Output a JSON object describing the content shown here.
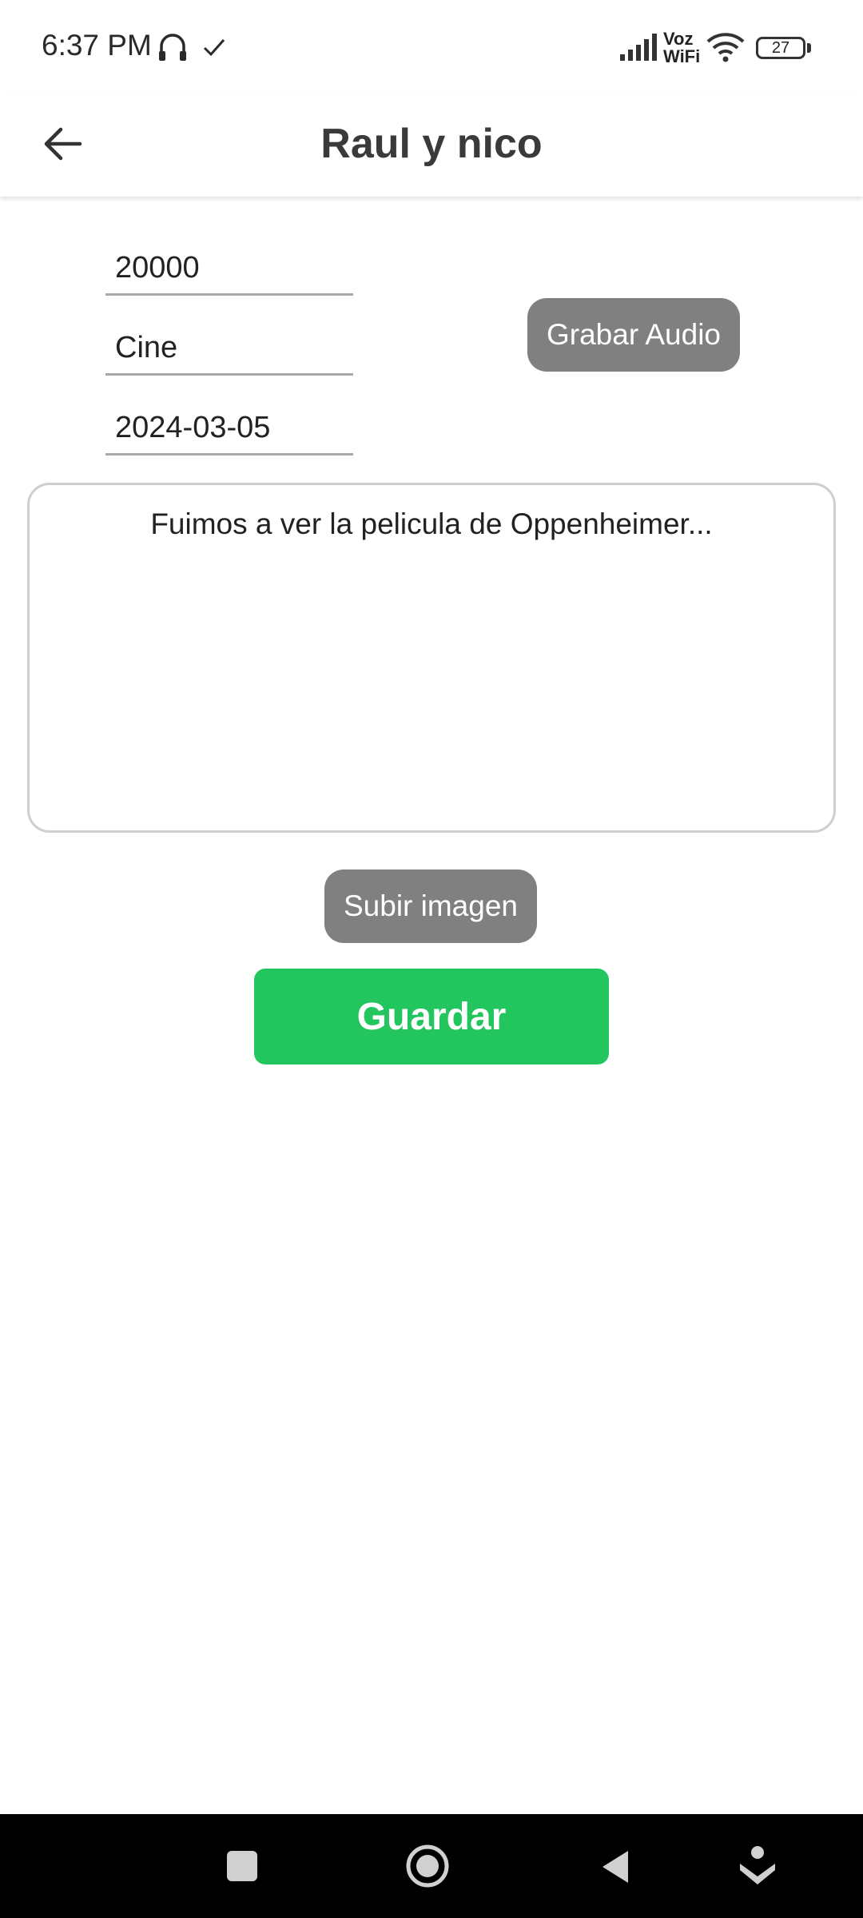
{
  "status_bar": {
    "time": "6:37 PM",
    "network_label_1": "Voz",
    "network_label_2": "WiFi",
    "battery": "27"
  },
  "app_bar": {
    "title": "Raul y nico",
    "back_icon": "arrow-left-icon"
  },
  "form": {
    "amount": "20000",
    "category": "Cine",
    "date": "2024-03-05",
    "description": "Fuimos a ver la pelicula de Oppenheimer..."
  },
  "buttons": {
    "record_audio": "Grabar Audio",
    "upload_image": "Subir imagen",
    "save": "Guardar"
  },
  "colors": {
    "save_button": "#22c55e",
    "secondary_button": "#808080"
  }
}
